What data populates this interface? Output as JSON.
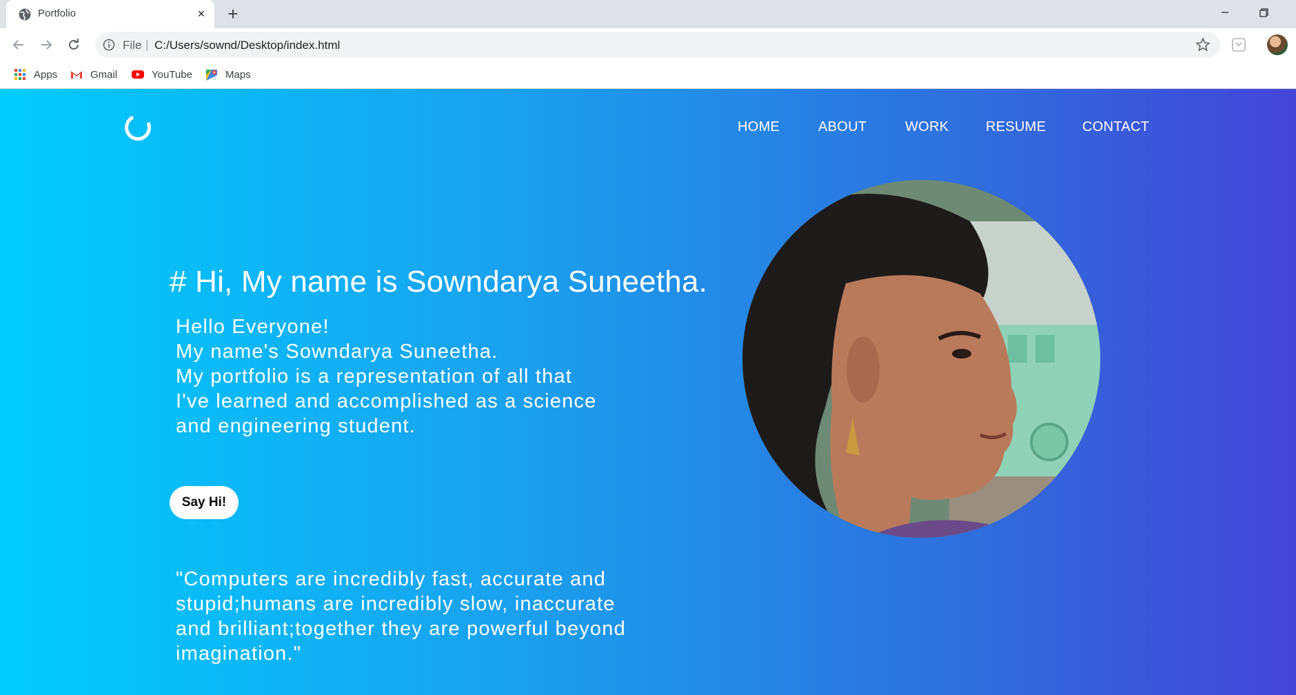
{
  "browser": {
    "tab": {
      "title": "Portfolio",
      "favicon": "globe-icon",
      "close": "×"
    },
    "new_tab": "+",
    "address": {
      "scheme_label": "File",
      "separator": "|",
      "url": "C:/Users/sownd/Desktop/index.html"
    },
    "bookmarks": [
      {
        "label": "Apps",
        "icon": "apps-grid-icon"
      },
      {
        "label": "Gmail",
        "icon": "gmail-icon"
      },
      {
        "label": "YouTube",
        "icon": "youtube-icon"
      },
      {
        "label": "Maps",
        "icon": "maps-icon"
      }
    ]
  },
  "site": {
    "nav": [
      "HOME",
      "ABOUT",
      "WORK",
      "RESUME",
      "CONTACT"
    ],
    "headline": "# Hi, My name is Sowndarya Suneetha.",
    "intro_lines": [
      "Hello Everyone!",
      "My name's Sowndarya Suneetha.",
      "My portfolio is a representation of all that",
      "I've learned and accomplished as a science",
      "and engineering student."
    ],
    "cta_label": "Say Hi!",
    "quote_lines": [
      "\"Computers are incredibly fast, accurate and",
      "stupid;humans are incredibly slow, inaccurate",
      "and brilliant;together they are powerful beyond",
      "imagination.\""
    ],
    "colors": {
      "gradient_start": "#00ccfe",
      "gradient_end": "#4444d8",
      "text": "#ffffff"
    }
  }
}
